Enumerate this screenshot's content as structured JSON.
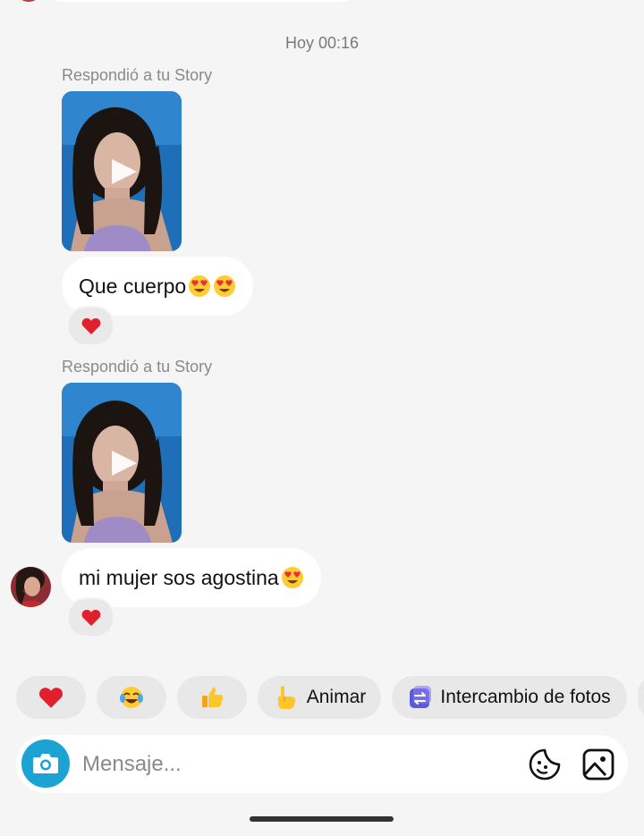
{
  "conversation": {
    "timestamp": "Hoy 00:16",
    "messages": [
      {
        "story_label": "Respondió a tu Story",
        "text": "Que cuerpo",
        "emoji": [
          "heart-eyes",
          "heart-eyes"
        ],
        "reaction": "red-heart"
      },
      {
        "story_label": "Respondió a tu Story",
        "text": "mi mujer sos agostina",
        "emoji": [
          "heart-eyes"
        ],
        "reaction": "red-heart"
      }
    ]
  },
  "quick_replies": [
    {
      "icon": "red-heart-emoji",
      "label": ""
    },
    {
      "icon": "tears-of-joy-emoji",
      "label": ""
    },
    {
      "icon": "thumbs-up-emoji",
      "label": ""
    },
    {
      "icon": "pointing-hand-emoji",
      "label": "Animar"
    },
    {
      "icon": "photo-swap-icon",
      "label": "Intercambio de fotos"
    }
  ],
  "composer": {
    "placeholder": "Mensaje..."
  },
  "colors": {
    "background": "#f5f5f5",
    "bubble": "#ffffff",
    "camera_button": "#1aa3d3",
    "photo_swap_accent": "#5b5bd6"
  }
}
